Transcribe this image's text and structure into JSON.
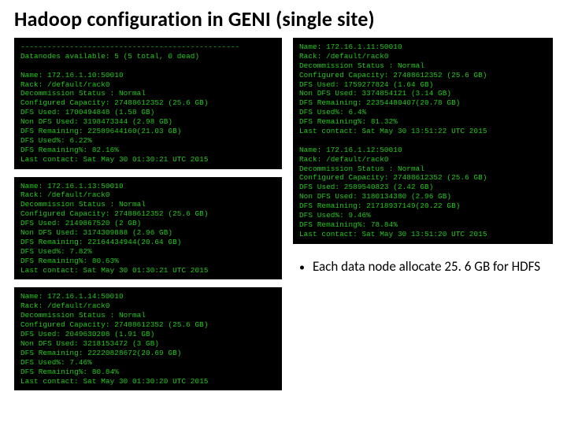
{
  "title": "Hadoop configuration in GENI (single site)",
  "bullet": "Each data node allocate 25. 6 GB for HDFS",
  "term_left_top": "-------------------------------------------------\nDatanodes available: 5 (5 total, 0 dead)\n\nName: 172.16.1.10:50010\nRack: /default/rack0\nDecommission Status : Normal\nConfigured Capacity: 27488612352 (25.6 GB)\nDFS Used: 1700494848 (1.58 GB)\nNon DFS Used: 3198473344 (2.98 GB)\nDFS Remaining: 22589644160(21.03 GB)\nDFS Used%: 6.22%\nDFS Remaining%: 82.16%\nLast contact: Sat May 30 01:30:21 UTC 2015",
  "term_left_mid": "Name: 172.16.1.13:50010\nRack: /default/rack0\nDecommission Status : Normal\nConfigured Capacity: 27488612352 (25.6 GB)\nDFS Used: 2149867520 (2 GB)\nNon DFS Used: 3174309888 (2.96 GB)\nDFS Remaining: 22164434944(20.64 GB)\nDFS Used%: 7.82%\nDFS Remaining%: 80.63%\nLast contact: Sat May 30 01:30:21 UTC 2015",
  "term_left_bot": "Name: 172.16.1.14:50010\nRack: /default/rack0\nDecommission Status : Normal\nConfigured Capacity: 27488612352 (25.6 GB)\nDFS Used: 2049630208 (1.91 GB)\nNon DFS Used: 3218153472 (3 GB)\nDFS Remaining: 22220828672(20.69 GB)\nDFS Used%: 7.46%\nDFS Remaining%: 80.84%\nLast contact: Sat May 30 01:30:20 UTC 2015",
  "term_right": "Name: 172.16.1.11:50010\nRack: /default/rack0\nDecommission Status : Normal\nConfigured Capacity: 27488612352 (25.6 GB)\nDFS Used: 1759277824 (1.64 GB)\nNon DFS Used: 3374854121 (3.14 GB)\nDFS Remaining: 22354480407(20.78 GB)\nDFS Used%: 6.4%\nDFS Remaining%: 81.32%\nLast contact: Sat May 30 13:51:22 UTC 2015\n\nName: 172.16.1.12:50010\nRack: /default/rack0\nDecommission Status : Normal\nConfigured Capacity: 27488612352 (25.6 GB)\nDFS Used: 2589540823 (2.42 GB)\nNon DFS Used: 3180134380 (2.96 GB)\nDFS Remaining: 21718937149(20.22 GB)\nDFS Used%: 9.46%\nDFS Remaining%: 78.84%\nLast contact: Sat May 30 13:51:20 UTC 2015"
}
